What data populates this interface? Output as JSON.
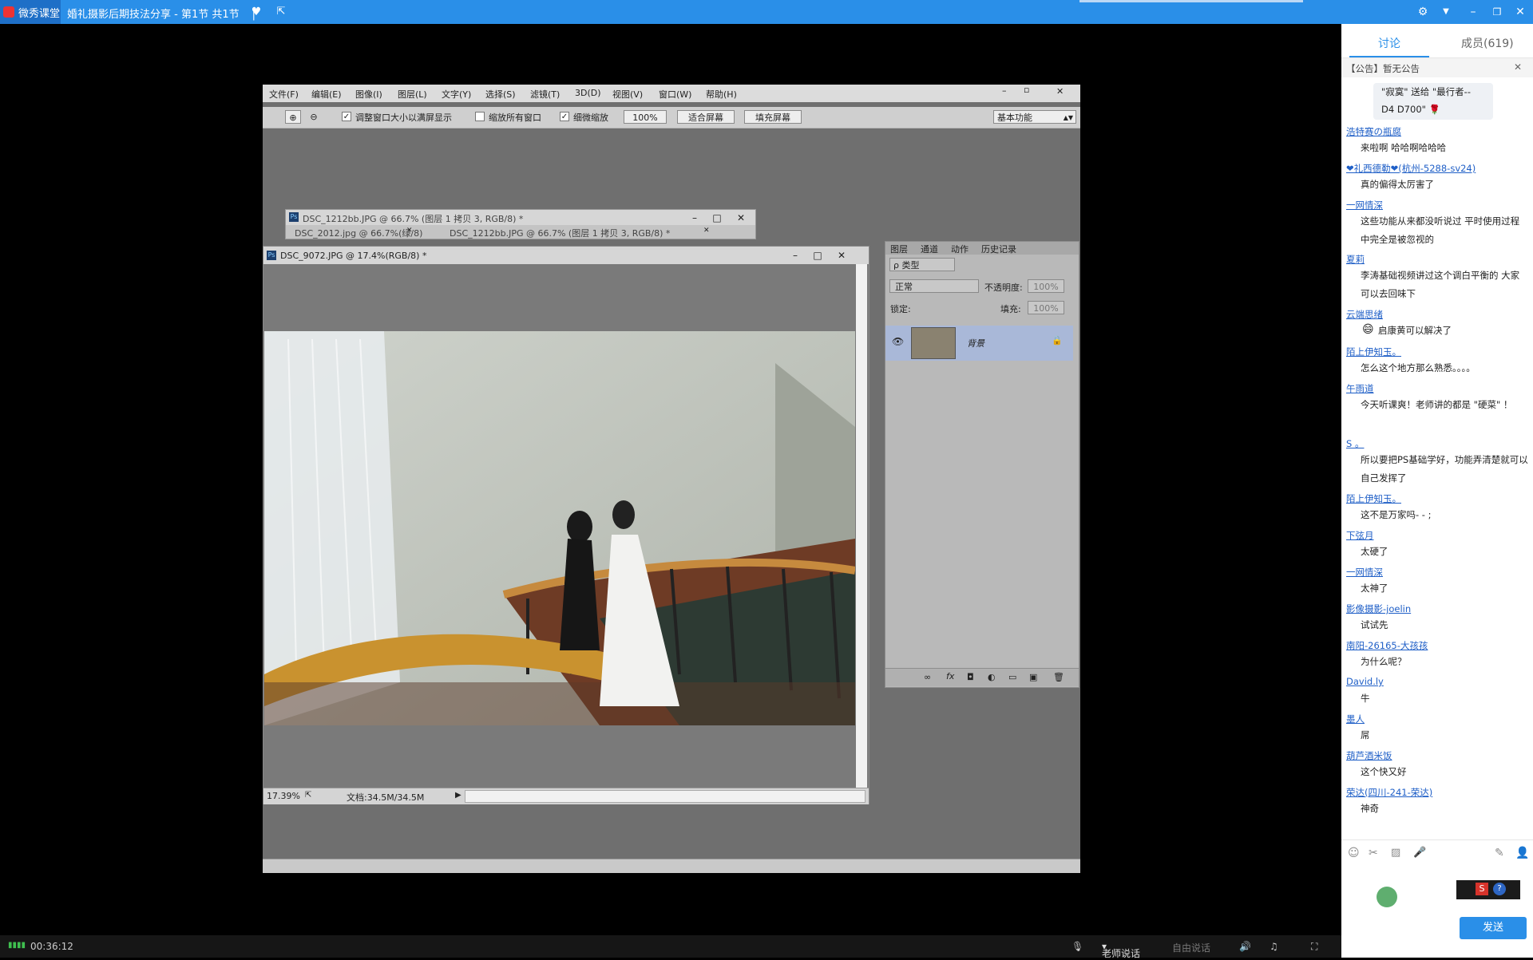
{
  "app": {
    "name": "微秀课堂",
    "title": "婚礼摄影后期技法分享 - 第1节 共1节",
    "separator": "|"
  },
  "photoshop": {
    "menu": [
      "文件(F)",
      "编辑(E)",
      "图像(I)",
      "图层(L)",
      "文字(Y)",
      "选择(S)",
      "滤镜(T)",
      "3D(D)",
      "视图(V)",
      "窗口(W)",
      "帮助(H)"
    ],
    "options": {
      "resize_windows": "调整窗口大小以满屏显示",
      "zoom_all": "缩放所有窗口",
      "scrubby_zoom": "细微缩放",
      "zoom_value": "100%",
      "fit_screen": "适合屏幕",
      "fill_screen": "填充屏幕",
      "workspace": "基本功能"
    },
    "doc_back": {
      "title": "DSC_1212bb.JPG @ 66.7% (图层 1 拷贝 3, RGB/8) *",
      "tabs": [
        "DSC_2012.jpg @ 66.7%(绿/8)",
        "DSC_1212bb.JPG @ 66.7% (图层 1 拷贝 3, RGB/8) *"
      ]
    },
    "doc_front": {
      "title": "DSC_9072.JPG @ 17.4%(RGB/8) *",
      "zoom": "17.39%",
      "doc_size": "文档:34.5M/34.5M"
    },
    "layers": {
      "tabs": [
        "图层",
        "通道",
        "动作",
        "历史记录"
      ],
      "kind": "ρ 类型",
      "blend": "正常",
      "opacity_label": "不透明度:",
      "opacity_value": "100%",
      "lock_label": "锁定:",
      "fill_label": "填充:",
      "fill_value": "100%",
      "layer_name": "背景"
    }
  },
  "sidebar": {
    "tabs": {
      "discussion": "讨论",
      "members": "成员(619)"
    },
    "notice": "【公告】暂无公告",
    "gift": {
      "line1": "\"寂寞\" 送给 \"最行者--",
      "line2": "D4  D700\""
    },
    "messages": [
      {
        "user": "浩特赛の瓶腐",
        "text": "来啦啊  哈哈啊哈哈哈"
      },
      {
        "user": "❤礼西德勒❤(杭州-5288-sv24)",
        "text": "真的偏得太厉害了"
      },
      {
        "user": "一网情深",
        "text": "这些功能从来都没听说过 平时使用过程中完全是被忽视的"
      },
      {
        "user": "夏莉",
        "text": "李涛基础视频讲过这个调白平衡的 大家可以去回味下"
      },
      {
        "user": "云端思绪",
        "text": "启康黄可以解决了"
      },
      {
        "user": "陌上伊知玉。",
        "text": "怎么这个地方那么熟悉。。。。"
      },
      {
        "user": "午雨道",
        "text": "今天听课爽！老师讲的都是 \"硬菜\" ！"
      },
      {
        "user": "S 。",
        "text": "所以要把PS基础学好，功能弄清楚就可以自己发挥了"
      },
      {
        "user": "陌上伊知玉。",
        "text": "这不是万家吗- - ;"
      },
      {
        "user": "下弦月",
        "text": "太硬了"
      },
      {
        "user": "一网情深",
        "text": "太神了"
      },
      {
        "user": "影像摄影-joelin",
        "text": "试试先"
      },
      {
        "user": "南阳-26165-大孩孩",
        "text": "为什么呢？"
      },
      {
        "user": "David.ly",
        "text": "牛"
      },
      {
        "user": "墨人",
        "text": "屌"
      },
      {
        "user": "葫芦酒米饭",
        "text": "这个快又好"
      },
      {
        "user": "荣达(四川-241-荣达)",
        "text": "神奇"
      }
    ],
    "send_button": "发送"
  },
  "bottom": {
    "time": "00:36:12",
    "teacher_talk": "老师说话",
    "free_talk": "自由说话"
  }
}
